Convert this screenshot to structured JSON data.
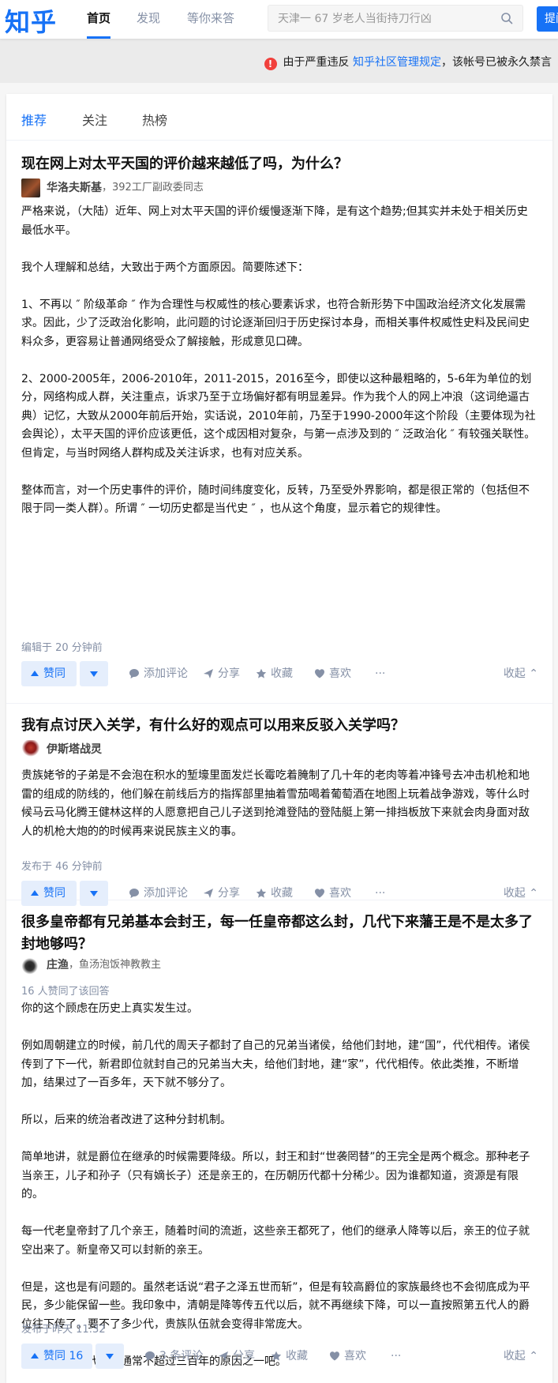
{
  "header": {
    "logo": "知乎",
    "nav": [
      "首页",
      "发现",
      "等你来答"
    ],
    "search_placeholder": "天津一 67 岁老人当街持刀行凶",
    "ask_label": "提问"
  },
  "banner": {
    "text_before": "由于严重违反",
    "link": "知乎社区管理规定",
    "text_after": "，该帐号已被永久禁言"
  },
  "tabs": [
    "推荐",
    "关注",
    "热榜"
  ],
  "answers": [
    {
      "title": "现在网上对太平天国的评价越来越低了吗，为什么？",
      "author": "华洛夫斯基",
      "bio": "，392工厂副政委同志",
      "paragraphs": [
        "严格来说，（大陆）近年、网上对太平天国的评价缓慢逐渐下降，是有这个趋势;但其实并未处于相关历史最低水平。",
        "我个人理解和总结，大致出于两个方面原因。简要陈述下：",
        "1、不再以 ″ 阶级革命 ″ 作为合理性与权威性的核心要素诉求，也符合新形势下中国政治经济文化发展需求。因此，少了泛政治化影响，此问题的讨论逐渐回归于历史探讨本身，而相关事件权威性史料及民间史料众多，更容易让普通网络受众了解接触，形成意见口碑。",
        "2、2000-2005年，2006-2010年，2011-2015，2016至今，即使以这种最粗略的，5-6年为单位的划分，网络构成人群，关注重点，诉求乃至于立场偏好都有明显差异。作为我个人的网上冲浪（这词绝逼古典）记忆，大致从2000年前后开始，实话说，2010年前，乃至于1990-2000年这个阶段（主要体现为社会舆论），太平天国的评价应该更低，这个成因相对复杂，与第一点涉及到的 ″ 泛政治化 ″ 有较强关联性。但肯定，与当时网络人群构成及关注诉求，也有对应关系。",
        "整体而言，对一个历史事件的评价，随时间纬度变化，反转，乃至受外界影响，都是很正常的（包括但不限于同一类人群）。所谓 ″ 一切历史都是当代史 ″ ，也从这个角度，显示着它的规律性。"
      ],
      "meta": "编辑于 20 分钟前",
      "vote_label": "赞同",
      "comment_label": "添加评论",
      "share_label": "分享",
      "fav_label": "收藏",
      "like_label": "喜欢",
      "more_label": "···",
      "collapse_label": "收起"
    },
    {
      "title": "我有点讨厌入关学，有什么好的观点可以用来反驳入关学吗？",
      "author": "伊斯塔战灵",
      "bio": "",
      "paragraphs": [
        "贵族姥爷的子弟是不会泡在积水的堑壕里面发烂长霉吃着腌制了几十年的老肉等着冲锋号去冲击机枪和地雷的组成的防线的，他们躲在前线后方的指挥部里抽着雪茄喝着葡萄酒在地图上玩着战争游戏，等什么时候马云马化腾王健林这样的人愿意把自己儿子送到抢滩登陆的登陆艇上第一排挡板放下来就会肉身面对敌人的机枪大炮的的时候再来说民族主义的事。"
      ],
      "meta": "发布于 46 分钟前",
      "vote_label": "赞同",
      "comment_label": "添加评论",
      "share_label": "分享",
      "fav_label": "收藏",
      "like_label": "喜欢",
      "more_label": "···",
      "collapse_label": "收起"
    },
    {
      "title": "很多皇帝都有兄弟基本会封王，每一任皇帝都这么封，几代下来藩王是不是太多了封地够吗？",
      "author": "庄渔",
      "bio": "，鱼汤泡饭神教教主",
      "upvote_note": "16 人赞同了该回答",
      "paragraphs": [
        "你的这个顾虑在历史上真实发生过。",
        "例如周朝建立的时候，前几代的周天子都封了自己的兄弟当诸侯，给他们封地，建“国”，代代相传。诸侯传到了下一代，新君即位就封自己的兄弟当大夫，给他们封地，建“家”，代代相传。依此类推，不断增加，结果过了一百多年，天下就不够分了。",
        "所以，后来的统治者改进了这种分封机制。",
        "简单地讲，就是爵位在继承的时候需要降级。所以，封王和封“世袭罔替”的王完全是两个概念。那种老子当亲王，儿子和孙子（只有嫡长子）还是亲王的，在历朝历代都十分稀少。因为谁都知道，资源是有限的。",
        "每一代老皇帝封了几个亲王，随着时间的流逝，这些亲王都死了，他们的继承人降等以后，亲王的位子就空出来了。新皇帝又可以封新的亲王。",
        "但是，这也是有问题的。虽然老话说“君子之泽五世而斩”，但是有较高爵位的家族最终也不会彻底成为平民，多少能保留一些。我印象中，清朝是降等传五代以后，就不再继续下降，可以一直按照第五代人的爵位往下传了。要不了多少代，贵族队伍就会变得非常庞大。",
        "这也许就是古代王朝通常不超过三百年的原因之一吧。"
      ],
      "meta": "发布于昨天 11:32",
      "vote_label": "赞同 16",
      "comment_label": "3 条评论",
      "share_label": "分享",
      "fav_label": "收藏",
      "like_label": "喜欢",
      "more_label": "···",
      "collapse_label": "收起"
    }
  ]
}
